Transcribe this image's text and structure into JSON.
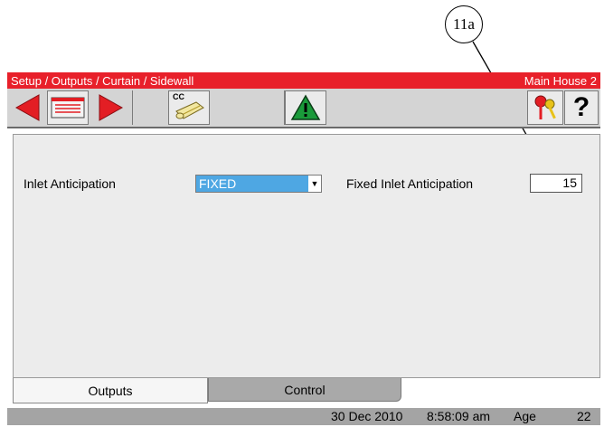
{
  "callout": {
    "label": "11a"
  },
  "header": {
    "breadcrumb": "Setup / Outputs / Curtain / Sidewall",
    "house_name": "Main House 2"
  },
  "toolbar": {
    "back_icon": "left-arrow-icon",
    "menu_icon": "list-card-icon",
    "forward_icon": "right-arrow-icon",
    "copy_icon_text": "CC",
    "copy_icon": "copy-config-icon",
    "alarm_icon": "warning-triangle-icon",
    "login_icon": "keys-icon",
    "help_label": "?",
    "colors": {
      "arrow": "#e31e24",
      "alarm": "#1a9a3a",
      "title_bar": "#e8202a",
      "selection": "#4ea7e3"
    }
  },
  "form": {
    "inlet_anticipation_label": "Inlet Anticipation",
    "inlet_anticipation_value": "FIXED",
    "fixed_inlet_anticipation_label": "Fixed Inlet Anticipation",
    "fixed_inlet_anticipation_value": "15"
  },
  "tabs": [
    {
      "label": "Outputs"
    },
    {
      "label": "Control"
    }
  ],
  "status": {
    "date": "30 Dec 2010",
    "time": "8:58:09 am",
    "age_label": "Age",
    "age_value": "22"
  }
}
